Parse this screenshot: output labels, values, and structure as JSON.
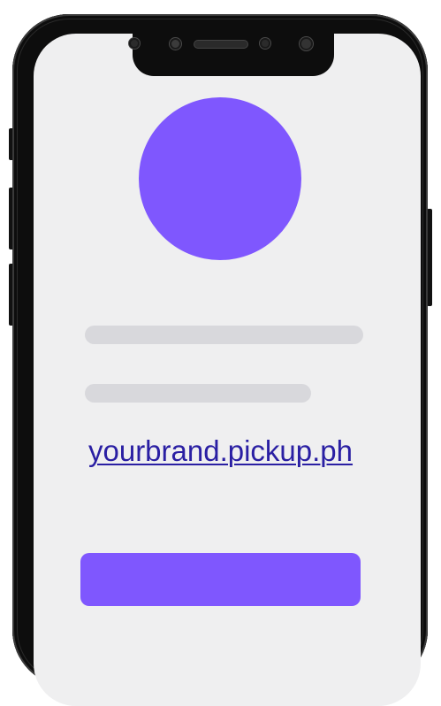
{
  "colors": {
    "accent": "#7f57fe",
    "link": "#2a1fa3",
    "screen_bg": "#efeff0",
    "placeholder": "#d8d8dc",
    "frame": "#0d0d0d"
  },
  "profile": {
    "link_text": "yourbrand.pickup.ph"
  },
  "action_button": {
    "label": ""
  },
  "icons": [
    "avatar-placeholder",
    "camera-icon",
    "speaker-icon",
    "sensor-icon"
  ]
}
